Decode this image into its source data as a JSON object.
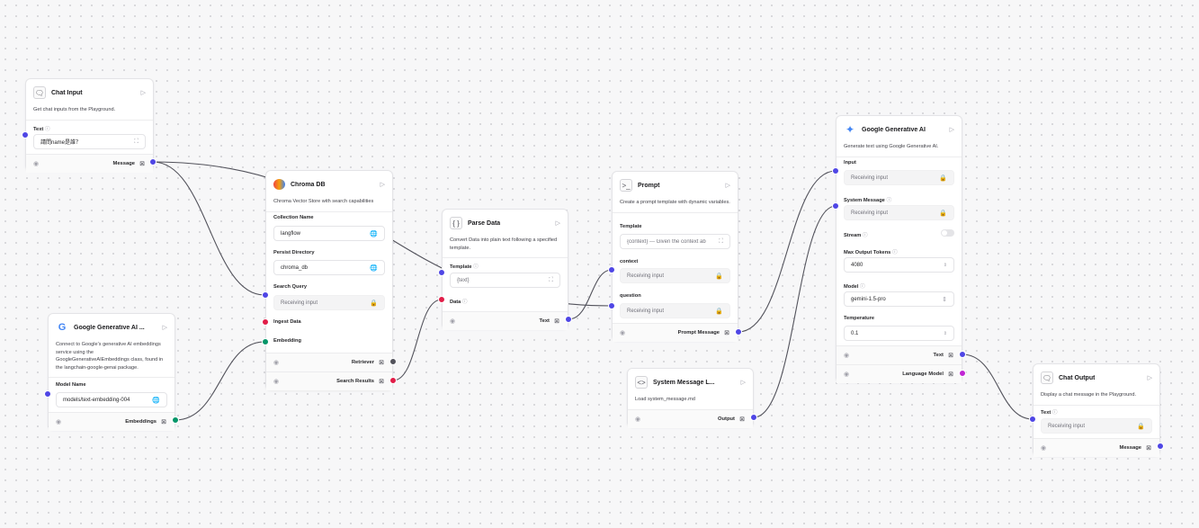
{
  "nodes": {
    "chat_input": {
      "title": "Chat Input",
      "description": "Get chat inputs from the Playground.",
      "field_text_label": "Text",
      "field_text_value": "請問name是誰？",
      "output_label": "Message"
    },
    "google_embeddings": {
      "title": "Google Generative AI ...",
      "description": "Connect to Google's generative AI embeddings service using the GoogleGenerativeAIEmbeddings class, found in the langchain-google-genai package.",
      "model_name_label": "Model Name",
      "model_name_value": "models/text-embedding-004",
      "output_label": "Embeddings"
    },
    "chroma_db": {
      "title": "Chroma DB",
      "description": "Chroma Vector Store with search capabilities",
      "collection_label": "Collection Name",
      "collection_value": "langflow",
      "persist_label": "Persist Directory",
      "persist_value": "chroma_db",
      "search_label": "Search Query",
      "search_value": "Receiving input",
      "ingest_label": "Ingest Data",
      "embedding_label": "Embedding",
      "output_retriever": "Retriever",
      "output_search_results": "Search Results"
    },
    "parse_data": {
      "title": "Parse Data",
      "description": "Convert Data into plain text following a specified template.",
      "template_label": "Template",
      "template_value": "{text}",
      "data_label": "Data",
      "output_label": "Text"
    },
    "prompt": {
      "title": "Prompt",
      "description": "Create a prompt template with dynamic variables.",
      "template_label": "Template",
      "template_value": "{context} --- Given the context ab",
      "context_label": "context",
      "context_value": "Receiving input",
      "question_label": "question",
      "question_value": "Receiving input",
      "output_label": "Prompt Message"
    },
    "system_message": {
      "title": "System Message L...",
      "description": "Load system_message.md",
      "output_label": "Output"
    },
    "google_llm": {
      "title": "Google Generative AI",
      "description": "Generate text using Google Generative AI.",
      "input_label": "Input",
      "input_value": "Receiving input",
      "system_label": "System Message",
      "system_value": "Receiving input",
      "stream_label": "Stream",
      "max_tokens_label": "Max Output Tokens",
      "max_tokens_value": "4080",
      "model_label": "Model",
      "model_value": "gemini-1.5-pro",
      "temperature_label": "Temperature",
      "temperature_value": "0.1",
      "output_text": "Text",
      "output_language_model": "Language Model"
    },
    "chat_output": {
      "title": "Chat Output",
      "description": "Display a chat message in the Playground.",
      "field_text_label": "Text",
      "field_text_value": "Receiving input",
      "output_label": "Message"
    }
  },
  "handle_colors": {
    "message": "#4f46e5",
    "data": "#e11d48",
    "embeddings": "#059669",
    "retriever": "#52525b",
    "language_model": "#c026d3"
  },
  "icons": {
    "chat_input": "chat-bubbles-icon",
    "google_embeddings": "google-g-logo",
    "chroma_db": "chroma-logo",
    "parse_data": "braces-icon",
    "prompt": "terminal-square-icon",
    "system_message": "code-brackets-icon",
    "google_llm": "gemini-sparkle-icon",
    "chat_output": "chat-bubbles-icon"
  }
}
